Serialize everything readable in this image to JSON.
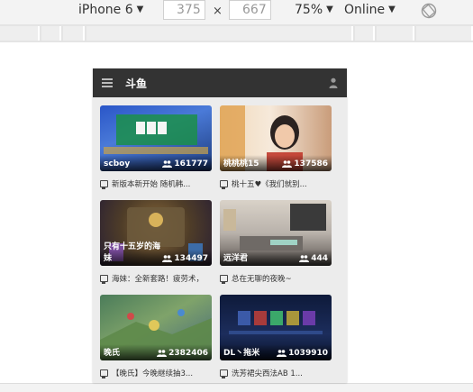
{
  "devtools": {
    "device": "iPhone 6",
    "width": "375",
    "height": "667",
    "zoom": "75%",
    "network": "Online",
    "rotate_icon": "rotate-icon"
  },
  "app": {
    "title": "斗鱼",
    "menu_icon": "hamburger-icon",
    "user_icon": "user-icon"
  },
  "rooms": [
    {
      "streamer": "scboy",
      "viewers": "161777",
      "title": "新版本新开始 随机韩..."
    },
    {
      "streamer": "桃桃桃15",
      "viewers": "137586",
      "title": "桃十五♥《我们就别..."
    },
    {
      "streamer": "只有十五岁的海妹",
      "viewers": "134497",
      "title": "海妹：全新套路！疲劳术，"
    },
    {
      "streamer": "远洋君",
      "viewers": "444",
      "title": "总在无聊的夜晚~"
    },
    {
      "streamer": "晚氏",
      "viewers": "2382406",
      "title": "【晚氏】今晚继续抽3..."
    },
    {
      "streamer": "DL丶拖米",
      "viewers": "1039910",
      "title": "洗芳裙尖西法AB 1..."
    }
  ]
}
